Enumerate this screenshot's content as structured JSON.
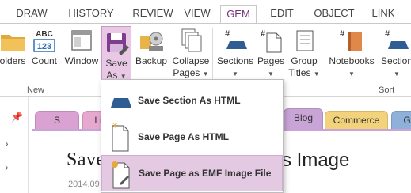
{
  "tabs": [
    "DRAW",
    "HISTORY",
    "REVIEW",
    "VIEW",
    "GEM",
    "EDIT",
    "OBJECT",
    "LINK"
  ],
  "active_tab": "GEM",
  "ribbon": {
    "buttons": {
      "folders": "olders",
      "count": "Count",
      "count_icon_text": "ABC",
      "count_icon_num": "123",
      "window": "Window",
      "save_as_1": "Save",
      "save_as_2": "As",
      "backup": "Backup",
      "collapse_pages_1": "Collapse",
      "collapse_pages_2": "Pages",
      "sections": "Sections",
      "pages": "Pages",
      "group_titles_1": "Group",
      "group_titles_2": "Titles",
      "notebooks": "Notebooks",
      "section": "Section"
    },
    "groups": {
      "new": "New",
      "sort": "Sort"
    }
  },
  "section_tabs": [
    {
      "label": "S",
      "color": "#d9a2d3"
    },
    {
      "label": "Li",
      "color": "#e6a8cf"
    },
    {
      "label": "Blog",
      "color": "#c9a4d6"
    },
    {
      "label": "Commerce",
      "color": "#f2d27a"
    },
    {
      "label": "G",
      "color": "#8fb1d9"
    }
  ],
  "pin_icon": "pin-icon",
  "note": {
    "title_left": "Save",
    "title_right": "s Image",
    "date": "2014.09"
  },
  "dropdown": {
    "items": [
      {
        "label": "Save Section As HTML",
        "icon": "section-icon"
      },
      {
        "label": "Save Page As HTML",
        "icon": "page-new-icon"
      },
      {
        "label": "Save Page as EMF Image File",
        "icon": "page-edit-icon"
      }
    ],
    "highlighted_index": 2
  },
  "colors": {
    "accent": "#7a2f7a",
    "selected_button": "#e8c8e5",
    "highlight_item": "#e4c9e3",
    "blog_tab": "#c9a4d6"
  }
}
